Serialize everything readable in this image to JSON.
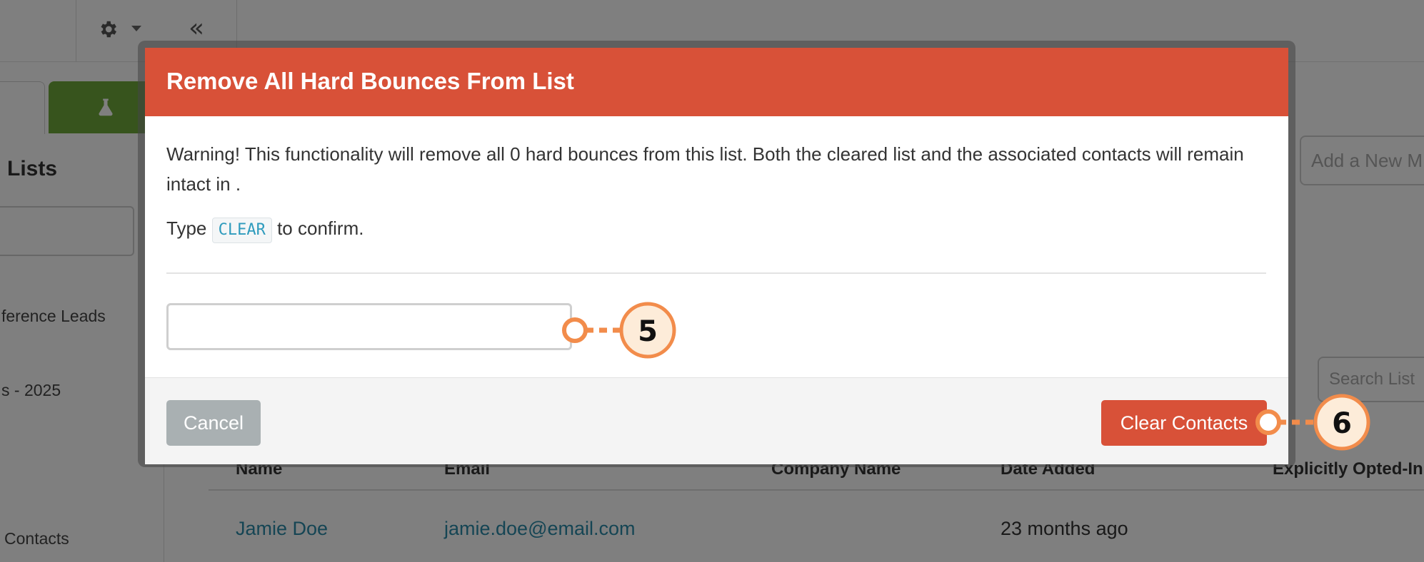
{
  "background": {
    "sidebar": {
      "title": "Lists",
      "items": [
        "ference Leads",
        "s - 2025",
        "Contacts"
      ]
    },
    "main": {
      "add_button_label": "Add a New M",
      "search_placeholder": "Search List"
    },
    "table": {
      "columns": [
        "Name",
        "Email",
        "Company Name",
        "Date Added",
        "Explicitly Opted-In"
      ],
      "rows": [
        {
          "name": "Jamie Doe",
          "email": "jamie.doe@email.com",
          "company": "",
          "date_added": "23 months ago"
        }
      ]
    }
  },
  "modal": {
    "title": "Remove All Hard Bounces From List",
    "warning": "Warning! This functionality will remove all 0 hard bounces from this list. Both the cleared list and the associated contacts will remain intact in .",
    "type_prefix": "Type",
    "confirm_code": "CLEAR",
    "type_suffix": "to confirm.",
    "input_value": "",
    "cancel_label": "Cancel",
    "clear_label": "Clear Contacts"
  },
  "callouts": [
    {
      "number": "5",
      "target": "confirm-input"
    },
    {
      "number": "6",
      "target": "clear-contacts-button"
    }
  ],
  "colors": {
    "accent": "#d85138",
    "callout": "#f28c4b",
    "link": "#2a8aa8",
    "green_tab": "#6fa83a"
  }
}
